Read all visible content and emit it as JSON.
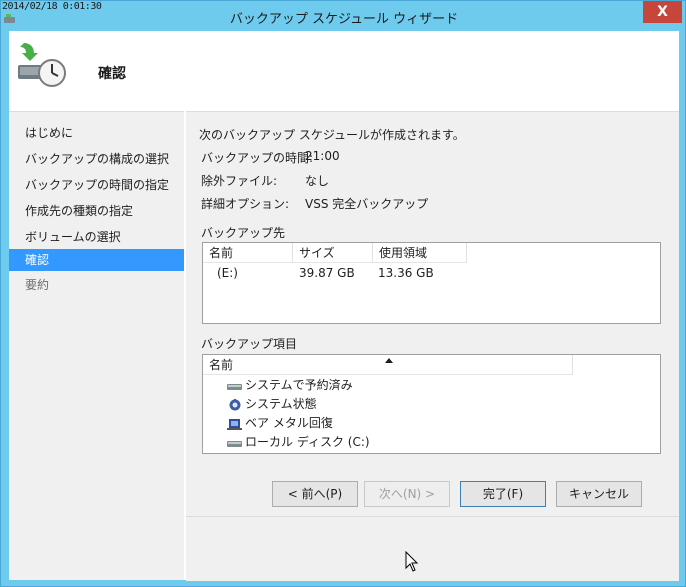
{
  "titlebar": {
    "timestamp": "2014/02/18 0:01:30",
    "title": "バックアップ スケジュール ウィザード",
    "close_label": "X"
  },
  "header": {
    "title": "確認"
  },
  "nav": {
    "items": [
      {
        "label": "はじめに",
        "state": "normal"
      },
      {
        "label": "バックアップの構成の選択",
        "state": "normal"
      },
      {
        "label": "バックアップの時間の指定",
        "state": "normal"
      },
      {
        "label": "作成先の種類の指定",
        "state": "normal"
      },
      {
        "label": "ボリュームの選択",
        "state": "normal"
      },
      {
        "label": "確認",
        "state": "active"
      },
      {
        "label": "要約",
        "state": "disabled"
      }
    ]
  },
  "summary": {
    "intro": "次のバックアップ スケジュールが作成されます。",
    "rows": [
      {
        "label": "バックアップの時間:",
        "value": "21:00"
      },
      {
        "label": "除外ファイル:",
        "value": "なし"
      },
      {
        "label": "詳細オプション:",
        "value": "VSS 完全バックアップ"
      }
    ]
  },
  "destination": {
    "group_label": "バックアップ先",
    "columns": [
      "名前",
      "サイズ",
      "使用領域"
    ],
    "rows": [
      {
        "name": "(E:)",
        "size": "39.87 GB",
        "used": "13.36 GB"
      }
    ]
  },
  "items": {
    "group_label": "バックアップ項目",
    "column": "名前",
    "rows": [
      {
        "label": "システムで予約済み",
        "icon": "drive-icon"
      },
      {
        "label": "システム状態",
        "icon": "system-state-icon"
      },
      {
        "label": "ベア メタル回復",
        "icon": "bare-metal-icon"
      },
      {
        "label": "ローカル ディスク (C:)",
        "icon": "drive-icon"
      }
    ]
  },
  "buttons": {
    "back": "< 前へ(P)",
    "next": "次へ(N) >",
    "finish": "完了(F)",
    "cancel": "キャンセル"
  },
  "colors": {
    "titlebar": "#6ecbee",
    "close": "#c7463c",
    "selection": "#3399ff"
  }
}
